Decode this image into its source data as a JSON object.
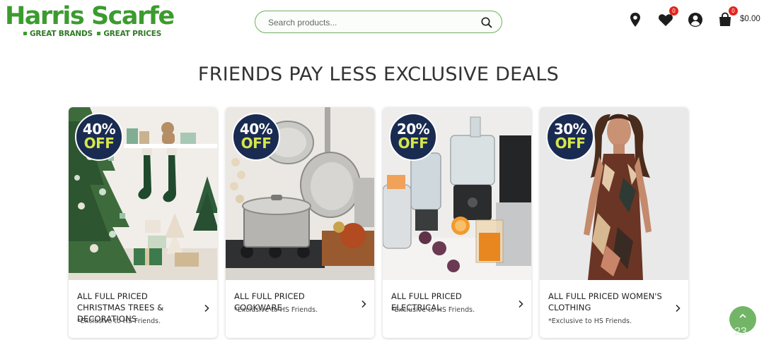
{
  "brand": {
    "name": "Harris Scarfe",
    "tagline_1": "GREAT BRANDS",
    "tagline_2": "GREAT PRICES",
    "color": "#3c9b2f"
  },
  "search": {
    "placeholder": "Search products..."
  },
  "header_icons": {
    "store_locator": "map-pin-icon",
    "wishlist": "heart-icon",
    "wishlist_count": "0",
    "account": "user-icon",
    "cart": "shopping-bag-icon",
    "cart_count": "0",
    "cart_total": "$0.00"
  },
  "page_title": "FRIENDS PAY LESS EXCLUSIVE DEALS",
  "deals": [
    {
      "percent": "40%",
      "off": "OFF",
      "title": "ALL FULL PRICED CHRISTMAS TREES & DECORATIONS",
      "note": "*Exclusive to HS Friends."
    },
    {
      "percent": "40%",
      "off": "OFF",
      "title": "ALL FULL PRICED COOKWARE",
      "note": "*Exclusive to HS Friends."
    },
    {
      "percent": "20%",
      "off": "OFF",
      "title": "ALL FULL PRICED ELECTRICAL",
      "note": "*Exclusive to HS Friends."
    },
    {
      "percent": "30%",
      "off": "OFF",
      "title": "ALL FULL PRICED WOMEN'S CLOTHING",
      "note": "*Exclusive to HS Friends."
    }
  ],
  "scroll_top": {
    "icon": "chevron-up-icon",
    "partial_text": "23"
  },
  "colors": {
    "badge_navy": "#1a2b52",
    "badge_off": "#d6e64a",
    "notification_red": "#e2261d",
    "scroll_green": "#72b567"
  }
}
